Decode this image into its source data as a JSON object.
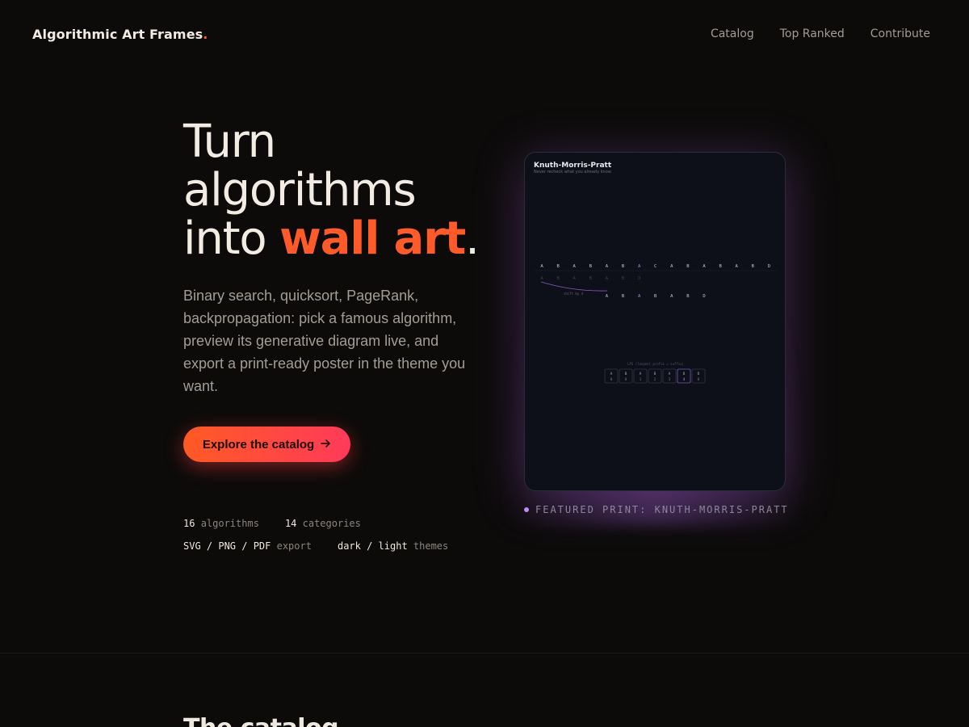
{
  "nav": {
    "brand": "Algorithmic Art Frames",
    "brand_dot": ".",
    "links": [
      "Catalog",
      "Top Ranked",
      "Contribute"
    ]
  },
  "hero": {
    "title_line1": "Turn",
    "title_line2": "algorithms",
    "title_line3_a": "into ",
    "title_line3_accent": "wall art",
    "title_line3_end": ".",
    "description": "Binary search, quicksort, PageRank, backpropagation: pick a famous algorithm, preview its generative diagram live, and export a print-ready poster in the theme you want.",
    "cta_label": "Explore the catalog",
    "cta_icon": "arrow-right-icon"
  },
  "stats": {
    "algorithms_count": "16",
    "algorithms_label": "algorithms",
    "categories_count": "14",
    "categories_label": "categories",
    "export_formats": "SVG / PNG / PDF",
    "export_label": "export",
    "themes_values": "dark / light",
    "themes_label": "themes"
  },
  "poster": {
    "title": "Knuth-Morris-Pratt",
    "subtitle": "Never recheck what you already know",
    "text_row": [
      "A",
      "B",
      "A",
      "B",
      "A",
      "B",
      "A",
      "C",
      "A",
      "B",
      "A",
      "B",
      "A",
      "B",
      "D"
    ],
    "pattern_ghost": [
      "A",
      "B",
      "A",
      "B",
      "A",
      "B",
      "D"
    ],
    "pattern_shift": [
      "A",
      "B",
      "A",
      "B",
      "A",
      "B",
      "D"
    ],
    "shift_label": "shift by 4",
    "lps_label": "LPS (longest prefix = suffix)",
    "lps_chars": [
      "A",
      "B",
      "A",
      "B",
      "A",
      "B",
      "D"
    ],
    "lps_values": [
      "0",
      "0",
      "1",
      "2",
      "3",
      "4",
      "0"
    ]
  },
  "featured": {
    "label": "FEATURED PRINT: KNUTH-MORRIS-PRATT"
  },
  "section": {
    "heading": "The catalog"
  },
  "colors": {
    "background": "#0c0b0a",
    "accent": "#ff5a2a",
    "poster_bg": "#0d0f19",
    "poster_glow": "#c38af5"
  }
}
